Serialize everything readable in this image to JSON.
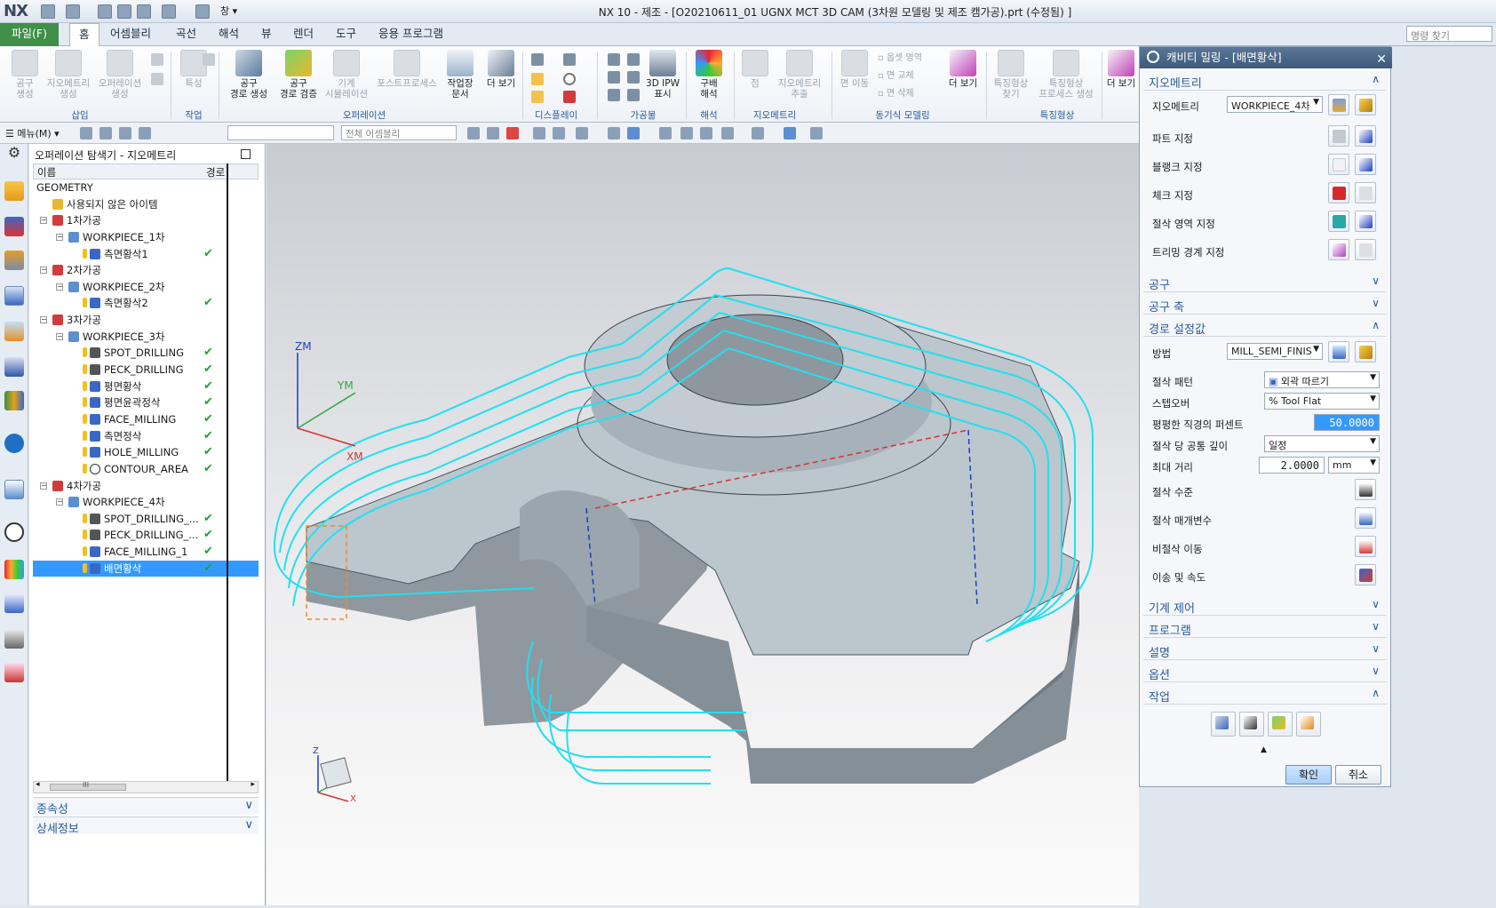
{
  "app": {
    "logo": "NX",
    "window_title": "NX 10 - 제조 - [O20210611_01 UGNX MCT 3D CAM (3차원 모델링 및 제조 캠가공).prt (수정됨) ]",
    "window_menu": "창",
    "command_search_placeholder": "명령 찾기"
  },
  "tabs": [
    "파일(F)",
    "홈",
    "어셈블리",
    "곡선",
    "해석",
    "뷰",
    "렌더",
    "도구",
    "응용 프로그램"
  ],
  "ribbon": {
    "buttons": [
      {
        "label": "공구\n생성",
        "dim": true
      },
      {
        "label": "지오메트리\n생성",
        "dim": true
      },
      {
        "label": "오퍼레이션\n생성",
        "dim": true
      },
      {
        "label": "특성",
        "dim": true
      },
      {
        "label": "공구\n경로 생성",
        "dim": false
      },
      {
        "label": "공구\n경로 검증",
        "dim": false
      },
      {
        "label": "기계\n시뮬레이션",
        "dim": true
      },
      {
        "label": "포스트프로세스",
        "dim": true
      },
      {
        "label": "작업장\n문서",
        "dim": false
      },
      {
        "label": "더 보기",
        "dim": false
      },
      {
        "label": "3D IPW\n표시",
        "dim": false
      },
      {
        "label": "구배\n해석",
        "dim": false
      },
      {
        "label": "점",
        "dim": true
      },
      {
        "label": "지오메트리\n추출",
        "dim": true
      },
      {
        "label": "면 이동",
        "dim": true
      },
      {
        "label": "더 보기",
        "dim": false
      },
      {
        "label": "특징형상\n찾기",
        "dim": true
      },
      {
        "label": "특징형상\n프로세스 생성",
        "dim": true
      },
      {
        "label": "더 보기",
        "dim": false
      }
    ],
    "sync_small": [
      "옵셋 영역",
      "면 교체",
      "면 삭제"
    ],
    "groups": [
      "삽입",
      "작업",
      "오퍼레이션",
      "디스플레이",
      "가공물",
      "해석",
      "지오메트리",
      "동기식 모델링",
      "특징형상"
    ]
  },
  "toolbar": {
    "menu_label": "메뉴(M)",
    "filter_placeholder": "",
    "assembly_scope": "전체 어셈블리"
  },
  "navigator": {
    "title": "오퍼레이션 탐색기 - 지오메트리",
    "col_name": "이름",
    "col_path": "경로",
    "rows": [
      {
        "label": "GEOMETRY",
        "indent": 0,
        "icon": "",
        "check": false
      },
      {
        "label": "사용되지 않은 아이템",
        "indent": 1,
        "icon": "folder",
        "check": false
      },
      {
        "label": "1차가공",
        "indent": 1,
        "icon": "mcs",
        "check": false
      },
      {
        "label": "WORKPIECE_1차",
        "indent": 2,
        "icon": "workpiece",
        "check": false
      },
      {
        "label": "측면황삭1",
        "indent": 3,
        "icon": "op",
        "check": true
      },
      {
        "label": "2차가공",
        "indent": 1,
        "icon": "mcs",
        "check": false
      },
      {
        "label": "WORKPIECE_2차",
        "indent": 2,
        "icon": "workpiece",
        "check": false
      },
      {
        "label": "측면황삭2",
        "indent": 3,
        "icon": "op",
        "check": true
      },
      {
        "label": "3차가공",
        "indent": 1,
        "icon": "mcs",
        "check": false
      },
      {
        "label": "WORKPIECE_3차",
        "indent": 2,
        "icon": "workpiece",
        "check": false
      },
      {
        "label": "SPOT_DRILLING",
        "indent": 3,
        "icon": "drill",
        "check": true
      },
      {
        "label": "PECK_DRILLING",
        "indent": 3,
        "icon": "drill",
        "check": true
      },
      {
        "label": "평면황삭",
        "indent": 3,
        "icon": "op",
        "check": true
      },
      {
        "label": "평면윤곽정삭",
        "indent": 3,
        "icon": "op",
        "check": true
      },
      {
        "label": "FACE_MILLING",
        "indent": 3,
        "icon": "op",
        "check": true
      },
      {
        "label": "측면정삭",
        "indent": 3,
        "icon": "op",
        "check": true
      },
      {
        "label": "HOLE_MILLING",
        "indent": 3,
        "icon": "op",
        "check": true
      },
      {
        "label": "CONTOUR_AREA",
        "indent": 3,
        "icon": "contour",
        "check": true
      },
      {
        "label": "4차가공",
        "indent": 1,
        "icon": "mcs",
        "check": false
      },
      {
        "label": "WORKPIECE_4차",
        "indent": 2,
        "icon": "workpiece",
        "check": false
      },
      {
        "label": "SPOT_DRILLING_...",
        "indent": 3,
        "icon": "drill",
        "check": true
      },
      {
        "label": "PECK_DRILLING_...",
        "indent": 3,
        "icon": "drill",
        "check": true
      },
      {
        "label": "FACE_MILLING_1",
        "indent": 3,
        "icon": "op",
        "check": true
      },
      {
        "label": "배면황삭",
        "indent": 3,
        "icon": "op",
        "check": true,
        "selected": true
      }
    ],
    "hscroll_grip": "III",
    "sections": [
      "종속성",
      "상세정보"
    ]
  },
  "viewport": {
    "axis_zm": "ZM",
    "axis_ym": "YM",
    "axis_xm": "XM",
    "triad_z": "Z",
    "triad_x": "X",
    "toolpath_color": "#22e0f0",
    "part_color": "#b9c3cb"
  },
  "dialog": {
    "title": "캐비티 밀링 - [배면황삭]",
    "geometry_section": "지오메트리",
    "geometry_label": "지오메트리",
    "geometry_value": "WORKPIECE_4차",
    "specify_rows": [
      "파트 지정",
      "블랭크 지정",
      "체크 지정",
      "절삭 영역 지정",
      "트리밍 경계 지정"
    ],
    "tool_section": "공구",
    "tool_axis_section": "공구 축",
    "path_section": "경로 설정값",
    "method_label": "방법",
    "method_value": "MILL_SEMI_FINIS",
    "cut_pattern_label": "절삭 패턴",
    "cut_pattern_value": "외곽 따르기",
    "stepover_label": "스텝오버",
    "stepover_value": "% Tool Flat",
    "flat_pct_label": "평평한 직경의 퍼센트",
    "flat_pct_value": "50.0000",
    "depth_label": "절삭 당 공통 깊이",
    "depth_value": "일정",
    "max_dist_label": "최대 거리",
    "max_dist_value": "2.0000",
    "max_dist_unit": "mm",
    "cut_levels_label": "절삭 수준",
    "cut_params_label": "절삭 매개변수",
    "noncut_label": "비절삭 이동",
    "feeds_label": "이송 및 속도",
    "machine_section": "기계 제어",
    "program_section": "프로그램",
    "desc_section": "설명",
    "options_section": "옵션",
    "actions_section": "작업",
    "ok": "확인",
    "cancel": "취소"
  }
}
